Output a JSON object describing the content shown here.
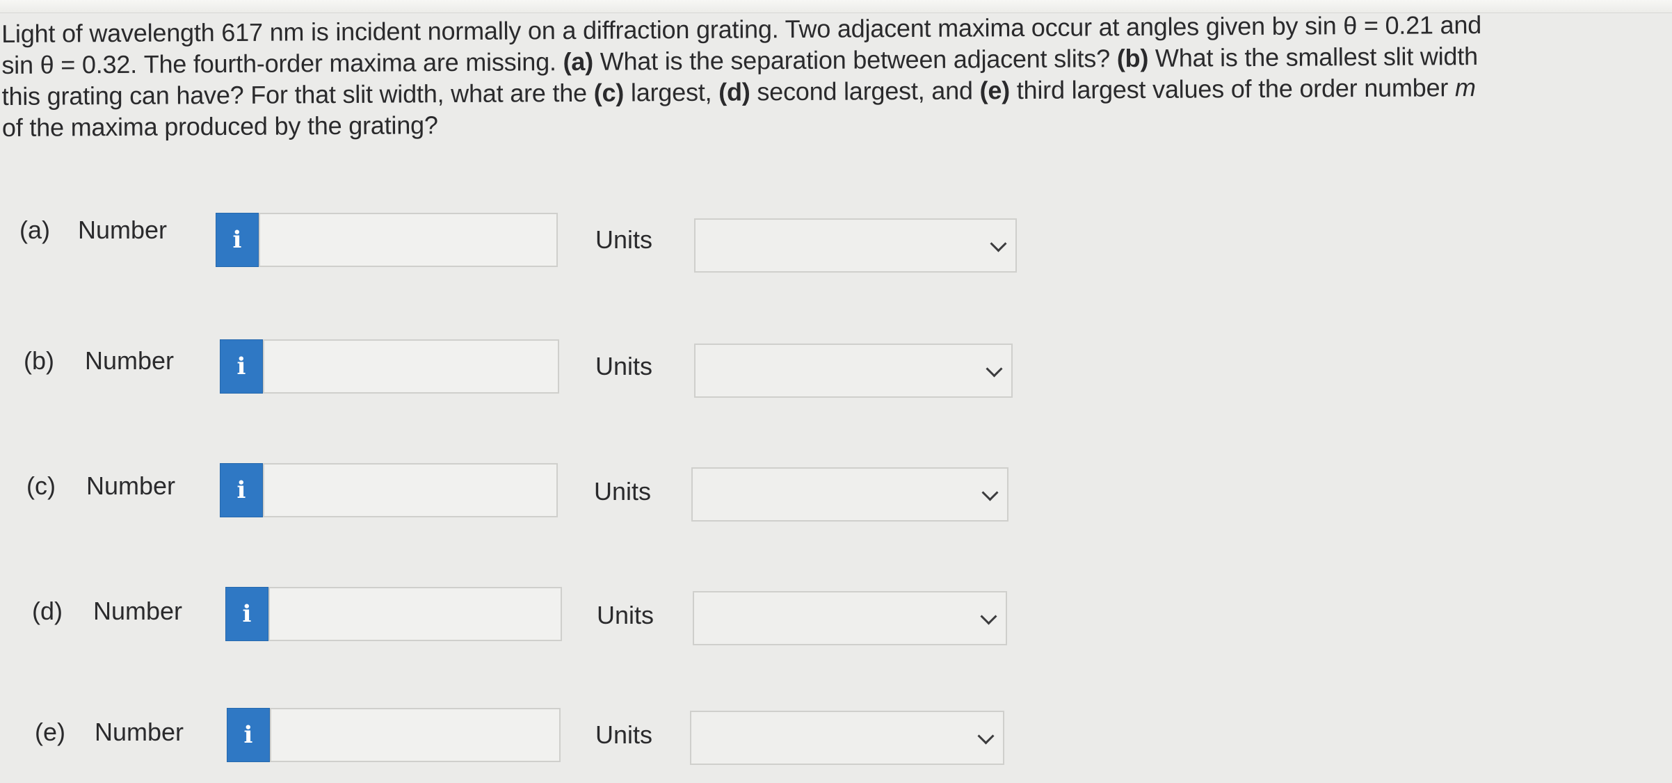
{
  "question": {
    "line1": "Light of wavelength 617 nm is incident normally on a diffraction grating. Two adjacent maxima occur at angles given by sin θ = 0.21 and",
    "line2a": "sin θ = 0.32. The fourth-order maxima are missing. ",
    "line2b": "(a)",
    "line2c": " What is the separation between adjacent slits? ",
    "line2d": "(b)",
    "line2e": " What is the smallest slit width",
    "line3a": "this grating can have? For that slit width, what are the ",
    "line3b": "(c)",
    "line3c": " largest, ",
    "line3d": "(d)",
    "line3e": " second largest, and ",
    "line3f": "(e)",
    "line3g": " third largest values of the order number ",
    "line3h": "m",
    "line4": "of the maxima produced by the grating?"
  },
  "parts": [
    {
      "label": "(a)",
      "number_label": "Number",
      "info": "i",
      "value": "",
      "units_label": "Units",
      "units_value": ""
    },
    {
      "label": "(b)",
      "number_label": "Number",
      "info": "i",
      "value": "",
      "units_label": "Units",
      "units_value": ""
    },
    {
      "label": "(c)",
      "number_label": "Number",
      "info": "i",
      "value": "",
      "units_label": "Units",
      "units_value": ""
    },
    {
      "label": "(d)",
      "number_label": "Number",
      "info": "i",
      "value": "",
      "units_label": "Units",
      "units_value": ""
    },
    {
      "label": "(e)",
      "number_label": "Number",
      "info": "i",
      "value": "",
      "units_label": "Units",
      "units_value": ""
    }
  ],
  "colors": {
    "info_button": "#2f78c4",
    "background": "#ebebe9"
  },
  "icons": {
    "info": "info-icon",
    "dropdown": "chevron-down-icon"
  }
}
